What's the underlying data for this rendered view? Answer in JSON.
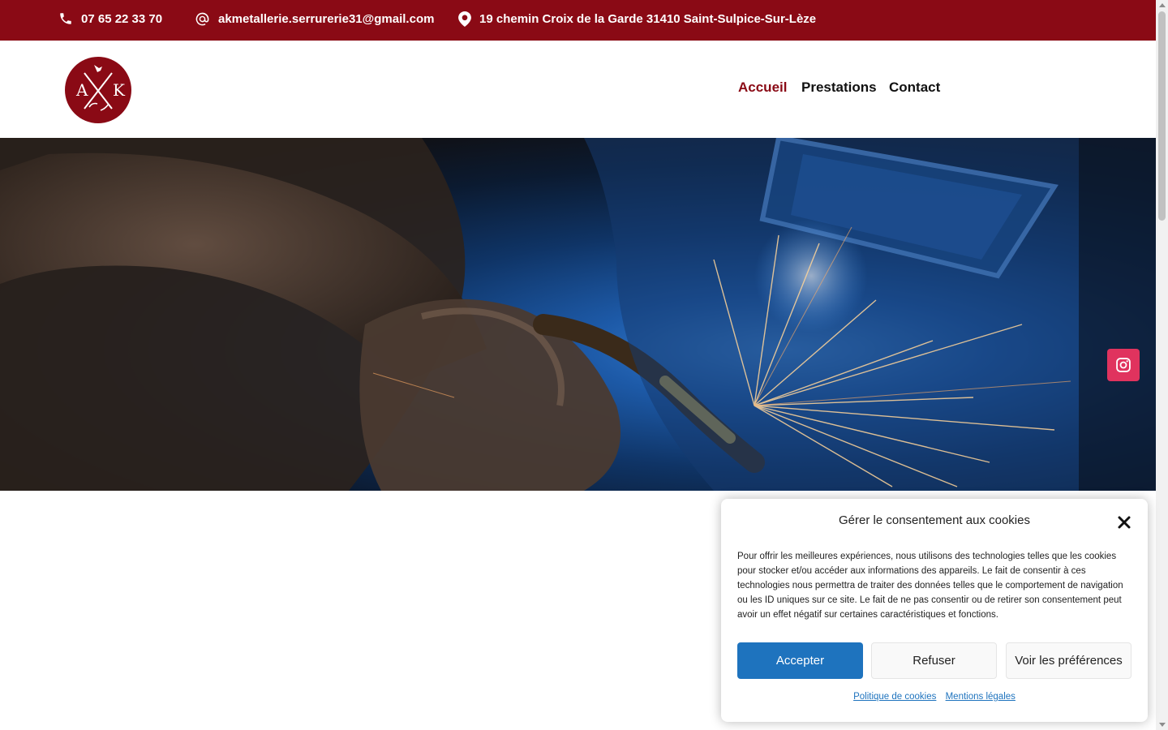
{
  "topbar": {
    "phone": "07 65 22 33 70",
    "email": "akmetallerie.serrurerie31@gmail.com",
    "address": "19 chemin Croix de la Garde 31410 Saint-Sulpice-Sur-Lèze"
  },
  "logo": {
    "letter_left": "A",
    "letter_right": "K"
  },
  "nav": {
    "items": [
      "Accueil",
      "Prestations",
      "Contact"
    ],
    "active": "Accueil"
  },
  "hero": {
    "image_description_icon": "welding-photo"
  },
  "social": {
    "icon": "instagram-icon"
  },
  "cookie": {
    "title": "Gérer le consentement aux cookies",
    "text": "Pour offrir les meilleures expériences, nous utilisons des technologies telles que les cookies pour stocker et/ou accéder aux informations des appareils. Le fait de consentir à ces technologies nous permettra de traiter des données telles que le comportement de navigation ou les ID uniques sur ce site. Le fait de ne pas consentir ou de retirer son consentement peut avoir un effet négatif sur certaines caractéristiques et fonctions.",
    "accept": "Accepter",
    "refuse": "Refuser",
    "prefs": "Voir les préférences",
    "link_cookies": "Politique de cookies",
    "link_legal": "Mentions légales"
  },
  "colors": {
    "brand": "#8a0a15",
    "accent_blue": "#1e73be",
    "instagram": "#e0335e"
  }
}
